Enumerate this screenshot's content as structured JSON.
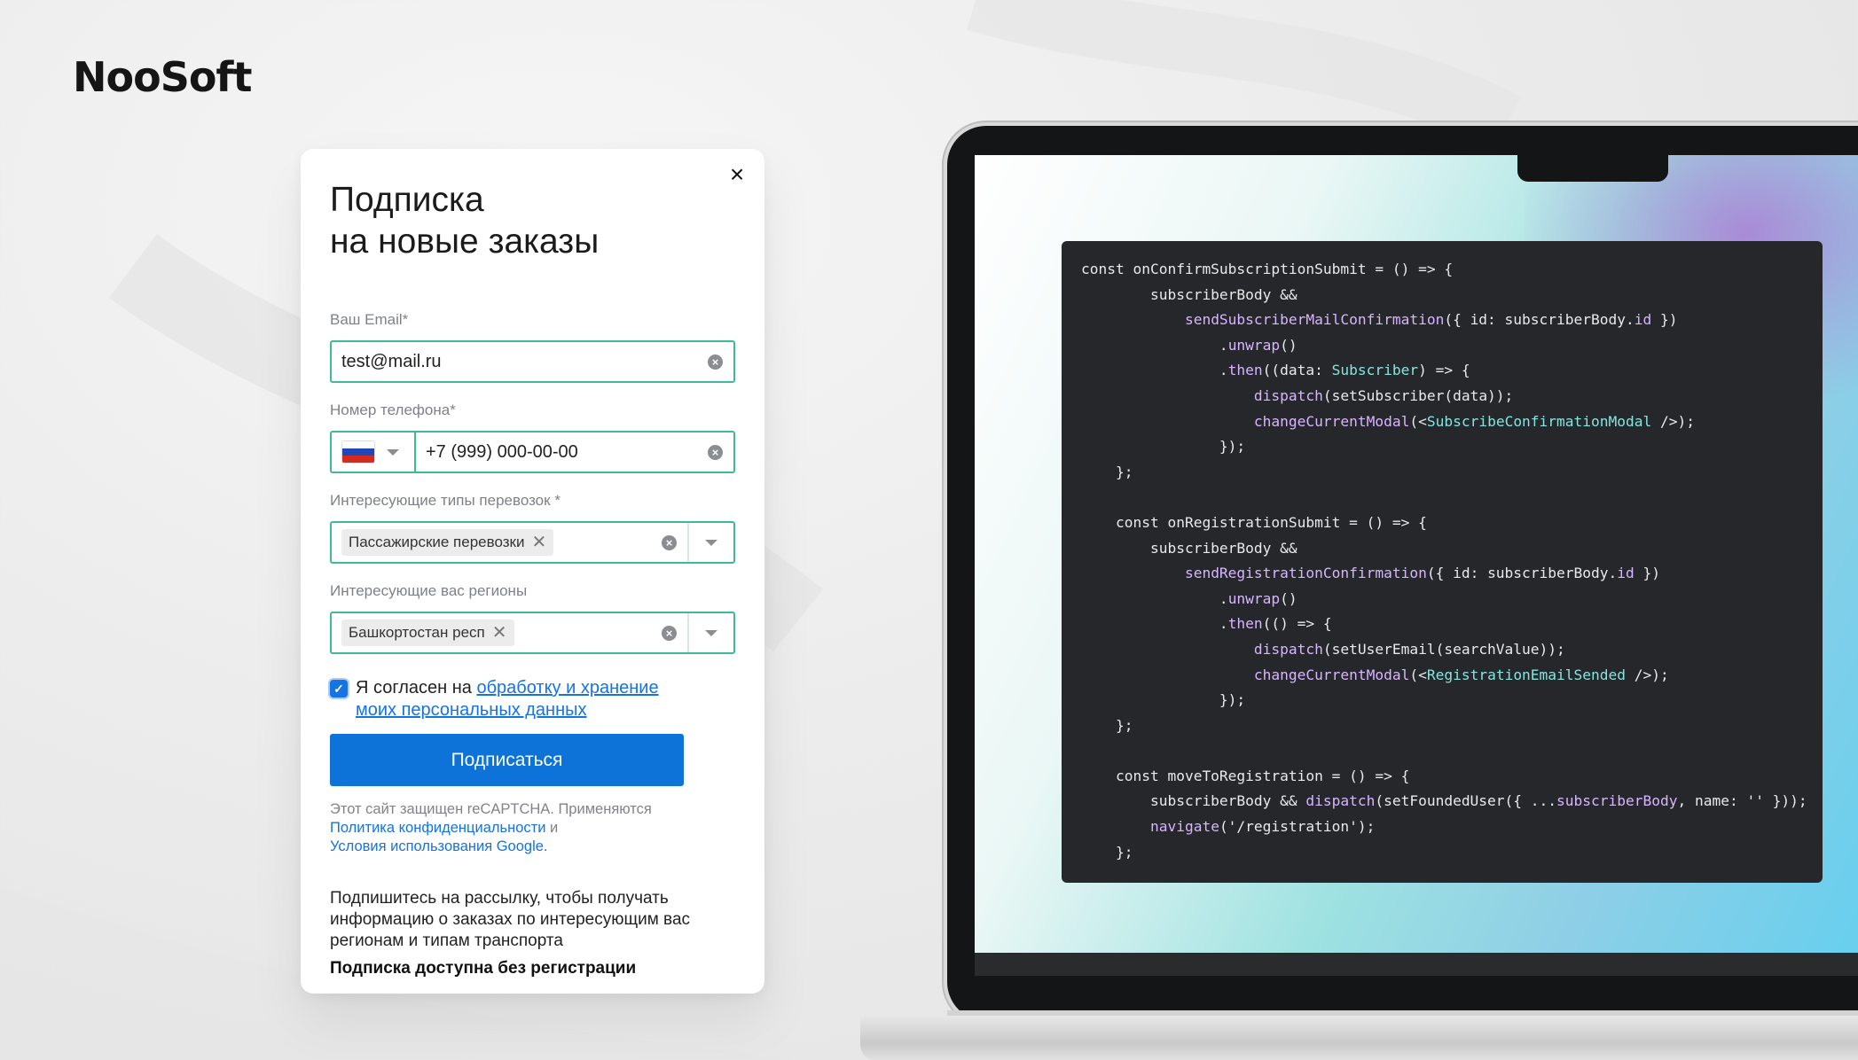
{
  "brand": {
    "logo": "NooSoft"
  },
  "modal": {
    "close_label": "×",
    "title_line1": "Подписка",
    "title_line2": "на новые заказы",
    "email": {
      "label": "Ваш Email",
      "required": "*",
      "value": "test@mail.ru"
    },
    "phone": {
      "label": "Номер телефона",
      "required": "*",
      "value": "+7 (999) 000-00-00",
      "country_flag": "ru-flag-icon"
    },
    "transport_types": {
      "label": "Интересующие типы перевозок",
      "required": "*",
      "selected": "Пассажирские перевозки"
    },
    "regions": {
      "label": "Интересующие вас регионы",
      "selected": "Башкортостан респ"
    },
    "consent": {
      "checked": true,
      "text": "Я согласен на ",
      "link_line1": "обработку и хранение",
      "link_line2": "моих персональных данных"
    },
    "submit_label": "Подписаться",
    "recaptcha": {
      "line1": "Этот сайт защищен reCAPTCHA. Применяются",
      "privacy_link": "Политика конфиденциальности",
      "and": " и",
      "terms_link": "Условия использования Google."
    },
    "info_text": "Подпишитесь на рассылку, чтобы получать информацию о заказах по интересующим вас регионам и типам транспорта",
    "info_bold": "Подписка доступна без регистрации"
  },
  "colors": {
    "accent": "#0d73d8",
    "field_border": "#3fb99a",
    "code_bg": "#25272b"
  },
  "code": {
    "lines": [
      [
        {
          "t": "const onConfirmSubscriptionSubmit = () => {",
          "c": "kw"
        }
      ],
      [
        {
          "t": "        subscriberBody &&",
          "c": "kw"
        }
      ],
      [
        {
          "t": "            ",
          "c": "kw"
        },
        {
          "t": "sendSubscriberMailConfirmation",
          "c": "fn"
        },
        {
          "t": "({ id: subscriberBody.",
          "c": "kw"
        },
        {
          "t": "id",
          "c": "fn"
        },
        {
          "t": " })",
          "c": "kw"
        }
      ],
      [
        {
          "t": "                .",
          "c": "kw"
        },
        {
          "t": "unwrap",
          "c": "fn"
        },
        {
          "t": "()",
          "c": "kw"
        }
      ],
      [
        {
          "t": "                .",
          "c": "kw"
        },
        {
          "t": "then",
          "c": "fn"
        },
        {
          "t": "((data: ",
          "c": "kw"
        },
        {
          "t": "Subscriber",
          "c": "ty"
        },
        {
          "t": ") => {",
          "c": "kw"
        }
      ],
      [
        {
          "t": "                    ",
          "c": "kw"
        },
        {
          "t": "dispatch",
          "c": "fn"
        },
        {
          "t": "(setSubscriber(data));",
          "c": "kw"
        }
      ],
      [
        {
          "t": "                    ",
          "c": "kw"
        },
        {
          "t": "changeCurrentModal",
          "c": "fn"
        },
        {
          "t": "(<",
          "c": "kw"
        },
        {
          "t": "SubscribeConfirmationModal",
          "c": "ty"
        },
        {
          "t": " />);",
          "c": "kw"
        }
      ],
      [
        {
          "t": "                });",
          "c": "kw"
        }
      ],
      [
        {
          "t": "    };",
          "c": "kw"
        }
      ],
      [
        {
          "t": "",
          "c": "kw"
        }
      ],
      [
        {
          "t": "    const onRegistrationSubmit = () => {",
          "c": "kw"
        }
      ],
      [
        {
          "t": "        subscriberBody &&",
          "c": "kw"
        }
      ],
      [
        {
          "t": "            ",
          "c": "kw"
        },
        {
          "t": "sendRegistrationConfirmation",
          "c": "fn"
        },
        {
          "t": "({ id: subscriberBody.",
          "c": "kw"
        },
        {
          "t": "id",
          "c": "fn"
        },
        {
          "t": " })",
          "c": "kw"
        }
      ],
      [
        {
          "t": "                .",
          "c": "kw"
        },
        {
          "t": "unwrap",
          "c": "fn"
        },
        {
          "t": "()",
          "c": "kw"
        }
      ],
      [
        {
          "t": "                .",
          "c": "kw"
        },
        {
          "t": "then",
          "c": "fn"
        },
        {
          "t": "(() => {",
          "c": "kw"
        }
      ],
      [
        {
          "t": "                    ",
          "c": "kw"
        },
        {
          "t": "dispatch",
          "c": "fn"
        },
        {
          "t": "(setUserEmail(searchValue));",
          "c": "kw"
        }
      ],
      [
        {
          "t": "                    ",
          "c": "kw"
        },
        {
          "t": "changeCurrentModal",
          "c": "fn"
        },
        {
          "t": "(<",
          "c": "kw"
        },
        {
          "t": "RegistrationEmailSended",
          "c": "ty"
        },
        {
          "t": " />);",
          "c": "kw"
        }
      ],
      [
        {
          "t": "                });",
          "c": "kw"
        }
      ],
      [
        {
          "t": "    };",
          "c": "kw"
        }
      ],
      [
        {
          "t": "",
          "c": "kw"
        }
      ],
      [
        {
          "t": "    const moveToRegistration = () => {",
          "c": "kw"
        }
      ],
      [
        {
          "t": "        subscriberBody && ",
          "c": "kw"
        },
        {
          "t": "dispatch",
          "c": "fn"
        },
        {
          "t": "(setFoundedUser({ ...",
          "c": "kw"
        },
        {
          "t": "subscriberBody",
          "c": "fn"
        },
        {
          "t": ", name: '' }));",
          "c": "kw"
        }
      ],
      [
        {
          "t": "        ",
          "c": "kw"
        },
        {
          "t": "navigate",
          "c": "fn"
        },
        {
          "t": "('/registration');",
          "c": "kw"
        }
      ],
      [
        {
          "t": "    };",
          "c": "kw"
        }
      ]
    ]
  }
}
